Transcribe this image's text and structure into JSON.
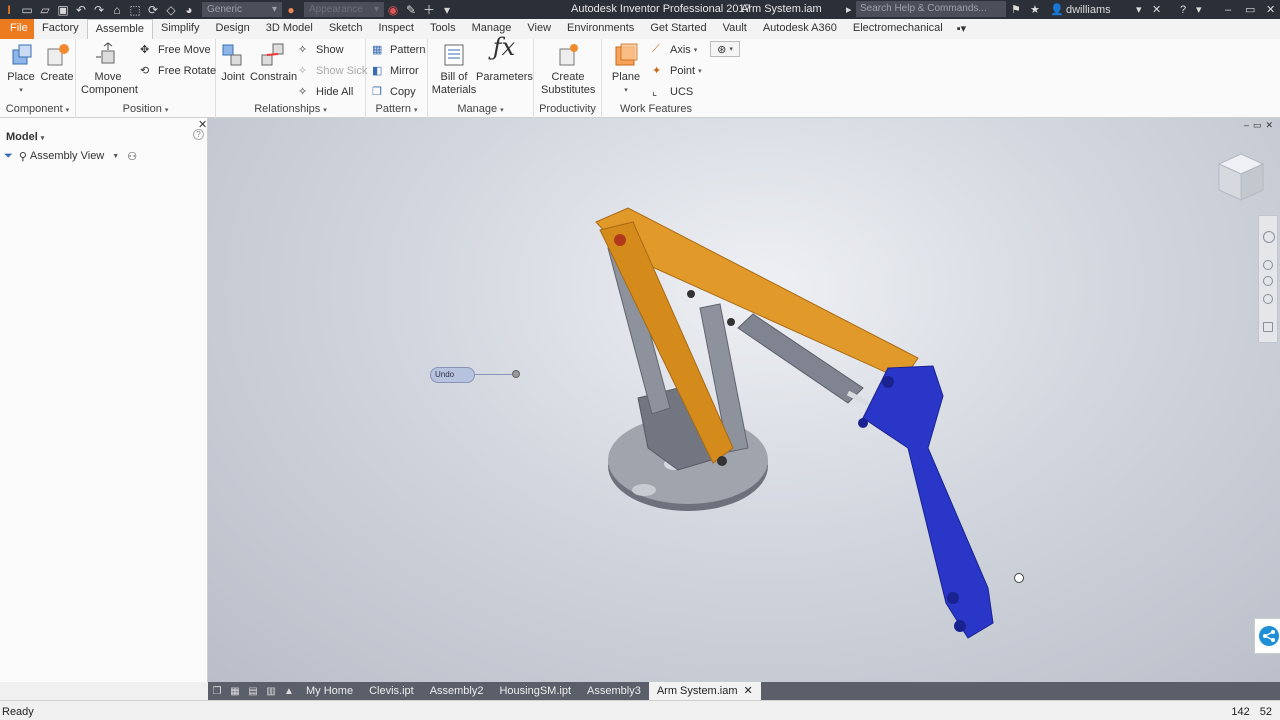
{
  "app": {
    "title": "Autodesk Inventor Professional 2017",
    "document": "Arm System.iam",
    "help_search_placeholder": "Search Help & Commands...",
    "user": "dwilliams"
  },
  "quick_access": {
    "material": "Generic",
    "appearance": "Appearance"
  },
  "tabs": [
    "File",
    "Factory",
    "Assemble",
    "Simplify",
    "Design",
    "3D Model",
    "Sketch",
    "Inspect",
    "Tools",
    "Manage",
    "View",
    "Environments",
    "Get Started",
    "Vault",
    "Autodesk A360",
    "Electromechanical"
  ],
  "active_tab": "Assemble",
  "ribbon": {
    "component": {
      "title": "Component",
      "place": "Place",
      "create": "Create"
    },
    "position": {
      "title": "Position",
      "move_component": "Move Component",
      "free_move": "Free Move",
      "free_rotate": "Free Rotate"
    },
    "relationships": {
      "title": "Relationships",
      "joint": "Joint",
      "constrain": "Constrain",
      "show": "Show",
      "show_sick": "Show Sick",
      "hide_all": "Hide All"
    },
    "pattern": {
      "title": "Pattern",
      "pattern": "Pattern",
      "mirror": "Mirror",
      "copy": "Copy"
    },
    "manage": {
      "title": "Manage",
      "bom": "Bill of Materials",
      "parameters": "Parameters"
    },
    "productivity": {
      "title": "Productivity",
      "create_substitutes": "Create Substitutes"
    },
    "work_features": {
      "title": "Work Features",
      "plane": "Plane",
      "axis": "Axis",
      "point": "Point",
      "ucs": "UCS"
    }
  },
  "browser": {
    "title": "Model",
    "view": "Assembly View"
  },
  "viewport": {
    "undo_label": "Undo"
  },
  "doc_tabs": [
    "My Home",
    "Clevis.ipt",
    "Assembly2",
    "HousingSM.ipt",
    "Assembly3",
    "Arm System.iam"
  ],
  "active_doc": "Arm System.iam",
  "status": {
    "text": "Ready",
    "num1": "142",
    "num2": "52"
  },
  "colors": {
    "arm_orange": "#e19a2a",
    "arm_blue": "#2a36c8",
    "steel": "#7f8490",
    "file_tab": "#ec7a1e",
    "titlebar": "#2b2f38"
  }
}
